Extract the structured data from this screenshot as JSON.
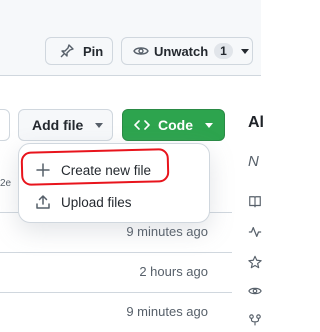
{
  "header": {
    "pin_label": "Pin",
    "unwatch_label": "Unwatch",
    "watch_count": "1"
  },
  "toolbar": {
    "add_file_label": "Add file",
    "code_label": "Code"
  },
  "add_file_menu": {
    "items": [
      {
        "label": "Create new file",
        "icon": "plus-icon"
      },
      {
        "label": "Upload files",
        "icon": "upload-icon"
      }
    ]
  },
  "file_list": {
    "commit_hash_fragment": "2e",
    "times": [
      "9 minutes ago",
      "2 hours ago",
      "9 minutes ago"
    ]
  },
  "sidebar": {
    "heading": "Al",
    "description_start": "N"
  },
  "colors": {
    "code_button": "#2da44e",
    "annotation": "#e8141c"
  }
}
